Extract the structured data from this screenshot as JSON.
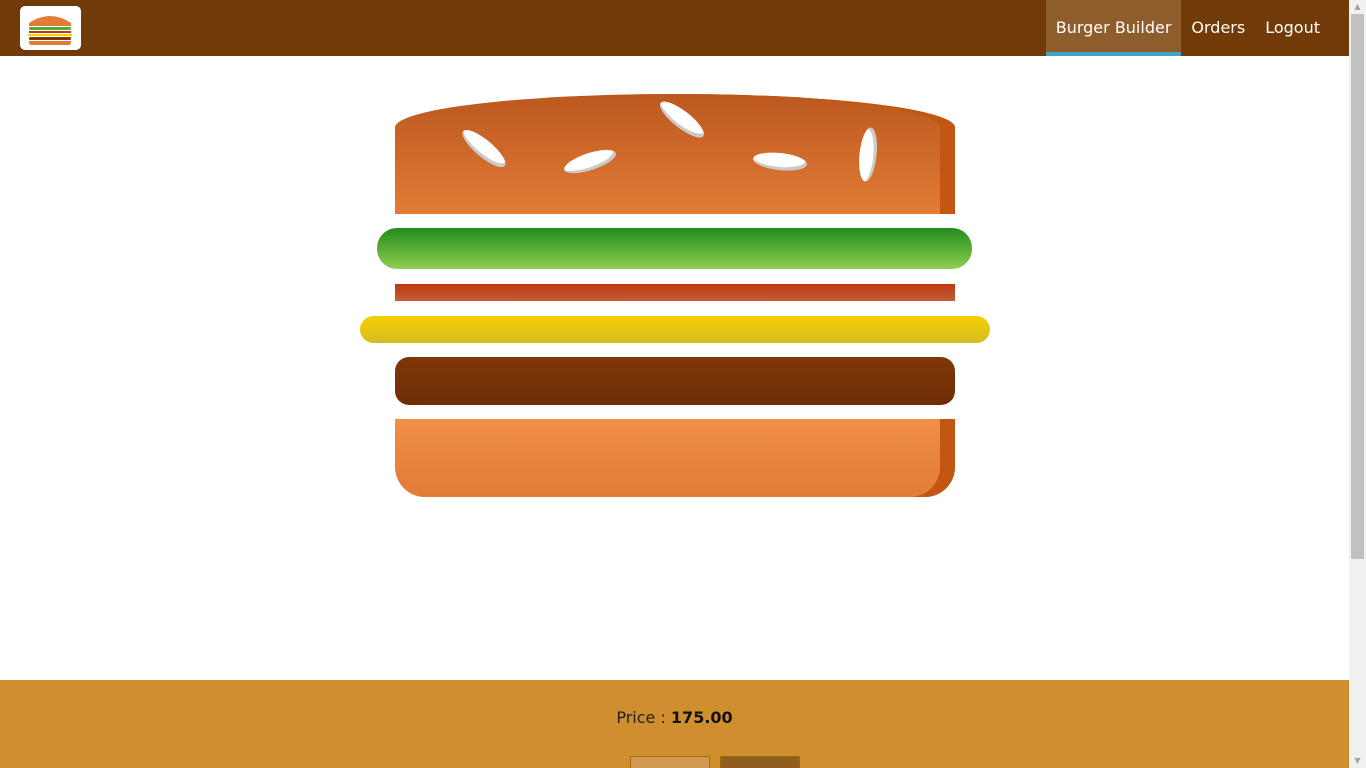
{
  "header": {
    "logo_alt": "burger-logo",
    "nav": [
      {
        "label": "Burger Builder",
        "active": true
      },
      {
        "label": "Orders",
        "active": false
      },
      {
        "label": "Logout",
        "active": false
      }
    ]
  },
  "burger": {
    "ingredients": [
      "bread-top",
      "salad",
      "bacon",
      "cheese",
      "meat",
      "bread-bottom"
    ]
  },
  "build_controls": {
    "price_label": "Price : ",
    "price_value": "175.00"
  },
  "colors": {
    "toolbar": "#703b09",
    "nav_active_bg": "#8f5c2c",
    "nav_active_underline": "#40a4c8",
    "controls_bg": "#cf8f2e",
    "bread": "#e27b36",
    "salad": "#228c1d",
    "bacon": "#bf3813",
    "cheese": "#f4d004",
    "meat": "#7f3608"
  }
}
